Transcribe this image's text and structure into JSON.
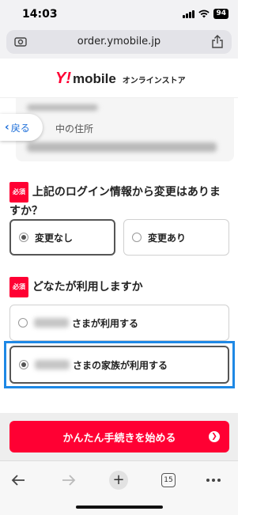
{
  "status_bar": {
    "time": "14:03",
    "battery": "94"
  },
  "browser": {
    "url": "order.ymobile.jp"
  },
  "header": {
    "logo_mark": "Y!",
    "logo_word": "mobile",
    "store_label": "オンラインストア"
  },
  "address_card": {
    "label": "中の住所"
  },
  "back_button": {
    "label": "戻る"
  },
  "question1": {
    "badge": "必須",
    "text": "上記のログイン情報から変更はありますか？",
    "options": [
      {
        "label": "変更なし",
        "selected": true
      },
      {
        "label": "変更あり",
        "selected": false
      }
    ]
  },
  "question2": {
    "badge": "必須",
    "text": "どなたが利用しますか",
    "options": [
      {
        "label": "さまが利用する",
        "selected": false
      },
      {
        "label": "さまの家族が利用する",
        "selected": true
      }
    ]
  },
  "cta": {
    "label": "かんたん手続きを始める"
  },
  "toolbar": {
    "tab_count": "15"
  },
  "colors": {
    "brand_red": "#ff0033",
    "highlight_blue": "#1e88e5",
    "link_blue": "#1e6fd9"
  }
}
